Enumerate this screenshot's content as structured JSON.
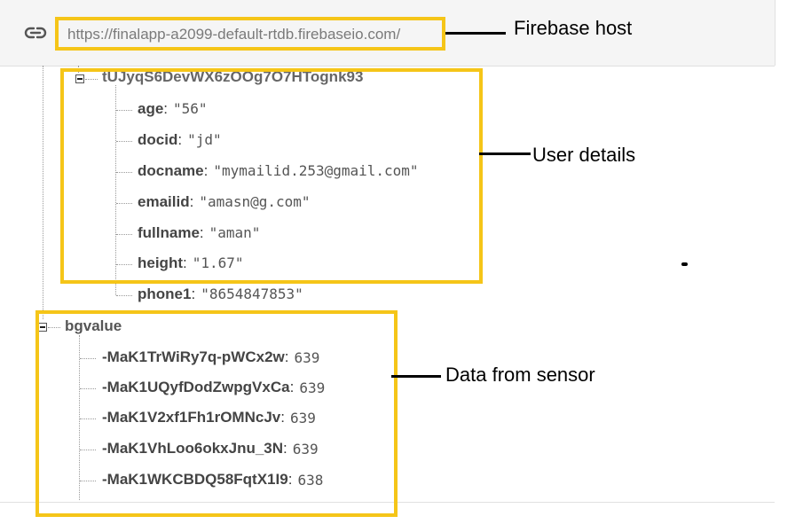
{
  "url_bar": {
    "url": "https://finalapp-a2099-default-rtdb.firebaseio.com/",
    "icon": "link-icon"
  },
  "user_node": {
    "key": "tUJyqS6DevWX6zOOg7O7HTognk93",
    "fields": [
      {
        "key": "age",
        "value": "\"56\""
      },
      {
        "key": "docid",
        "value": "\"jd\""
      },
      {
        "key": "docname",
        "value": "\"mymailid.253@gmail.com\""
      },
      {
        "key": "emailid",
        "value": "\"amasn@g.com\""
      },
      {
        "key": "fullname",
        "value": "\"aman\""
      },
      {
        "key": "height",
        "value": "\"1.67\""
      },
      {
        "key": "phone1",
        "value": "\"8654847853\""
      }
    ]
  },
  "bg_node": {
    "key": "bgvalue",
    "entries": [
      {
        "key": "-MaK1TrWiRy7q-pWCx2w",
        "value": "639"
      },
      {
        "key": "-MaK1UQyfDodZwpgVxCa",
        "value": "639"
      },
      {
        "key": "-MaK1V2xf1Fh1rOMNcJv",
        "value": "639"
      },
      {
        "key": "-MaK1VhLoo6okxJnu_3N",
        "value": "639"
      },
      {
        "key": "-MaK1WKCBDQ58FqtX1I9",
        "value": "638"
      }
    ]
  },
  "annotations": {
    "host": "Firebase host",
    "user": "User details",
    "sensor": "Data from sensor",
    "box_color": "#f5c518"
  }
}
